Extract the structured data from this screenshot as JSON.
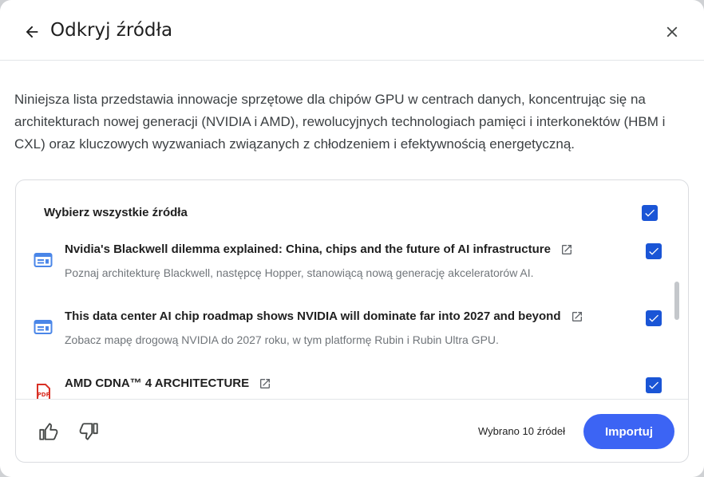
{
  "dialog": {
    "title": "Odkryj źródła",
    "description": "Niniejsza lista przedstawia innowacje sprzętowe dla chipów GPU w centrach danych, koncentrując się na architekturach nowej generacji (NVIDIA i AMD), rewolucyjnych technologiach pamięci i interkonektów (HBM i CXL) oraz kluczowych wyzwaniach związanych z chłodzeniem i efektywnością energetyczną."
  },
  "sources": {
    "select_all_label": "Wybierz wszystkie źródła",
    "items": [
      {
        "title": "Nvidia's Blackwell dilemma explained: China, chips and the future of AI infrastructure",
        "subtitle": "Poznaj architekturę Blackwell, następcę Hopper, stanowiącą nową generację akceleratorów AI.",
        "icon": "web-page-icon",
        "checked": true
      },
      {
        "title": "This data center AI chip roadmap shows NVIDIA will dominate far into 2027 and beyond",
        "subtitle": "Zobacz mapę drogową NVIDIA do 2027 roku, w tym platformę Rubin i Rubin Ultra GPU.",
        "icon": "web-page-icon",
        "checked": true
      },
      {
        "title": "AMD CDNA™ 4 ARCHITECTURE",
        "subtitle": "",
        "icon": "pdf-icon",
        "checked": true
      }
    ]
  },
  "footer": {
    "selected_count": "Wybrano 10 źródeł",
    "import_label": "Importuj"
  },
  "colors": {
    "accent": "#3c64f4",
    "checkbox": "#1a55d6",
    "web_icon": "#4a86e8",
    "pdf_icon": "#d93025"
  }
}
